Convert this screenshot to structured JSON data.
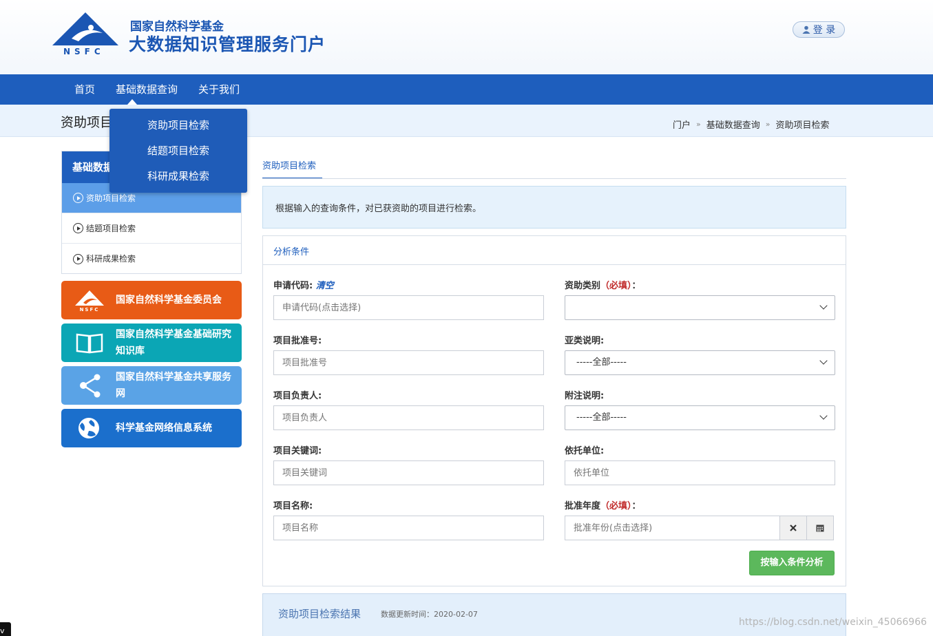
{
  "header": {
    "logo_text": "NSFC",
    "title_line1": "国家自然科学基金",
    "title_line2": "大数据知识管理服务门户",
    "login_label": "登 录"
  },
  "nav": {
    "items": [
      "首页",
      "基础数据查询",
      "关于我们"
    ]
  },
  "dropdown": {
    "items": [
      "资助项目检索",
      "结题项目检索",
      "科研成果检索"
    ]
  },
  "subheader": {
    "page_title": "资助项目检索",
    "breadcrumb": [
      "门户",
      "基础数据查询",
      "资助项目检索"
    ],
    "separator": "»"
  },
  "sidebar": {
    "heading": "基础数据查询",
    "items": [
      "资助项目检索",
      "结题项目检索",
      "科研成果检索"
    ],
    "links": [
      {
        "label": "国家自然科学基金委员会",
        "color": "#e85b16",
        "icon": "nsfc-logo-icon"
      },
      {
        "label": "国家自然科学基金基础研究知识库",
        "color": "#0ba6b5",
        "icon": "book-icon"
      },
      {
        "label": "国家自然科学基金共享服务网",
        "color": "#5aa3e6",
        "icon": "share-icon"
      },
      {
        "label": "科学基金网络信息系统",
        "color": "#1b6fcc",
        "icon": "globe-icon"
      }
    ]
  },
  "main": {
    "tab_label": "资助项目检索",
    "info_text": "根据输入的查询条件，对已获资助的项目进行检索。",
    "form_title": "分析条件",
    "fields": {
      "apply_code": {
        "label": "申请代码:",
        "clear": "清空",
        "placeholder": "申请代码(点击选择)"
      },
      "fund_type": {
        "label": "资助类别",
        "required": "（必填）",
        "suffix": "：",
        "value": ""
      },
      "approval_no": {
        "label": "项目批准号:",
        "placeholder": "项目批准号"
      },
      "sub_type": {
        "label": "亚类说明:",
        "value": "-----全部-----"
      },
      "leader": {
        "label": "项目负责人:",
        "placeholder": "项目负责人"
      },
      "note": {
        "label": "附注说明:",
        "value": "-----全部-----"
      },
      "keywords": {
        "label": "项目关键词:",
        "placeholder": "项目关键词"
      },
      "institution": {
        "label": "依托单位:",
        "placeholder": "依托单位"
      },
      "project_name": {
        "label": "项目名称:",
        "placeholder": "项目名称"
      },
      "approval_year": {
        "label": "批准年度",
        "required": "（必填）",
        "suffix": "：",
        "placeholder": "批准年份(点击选择)"
      }
    },
    "submit_label": "按输入条件分析",
    "result_title": "资助项目检索结果",
    "result_updated": "数据更新时间：2020-02-07"
  },
  "watermark": "https://blog.csdn.net/weixin_45066966",
  "corner_label": "v",
  "colors": {
    "primary": "#1e5ebd",
    "active_side": "#5c9ee8",
    "success": "#5cb85c",
    "required": "#c12a2a"
  }
}
